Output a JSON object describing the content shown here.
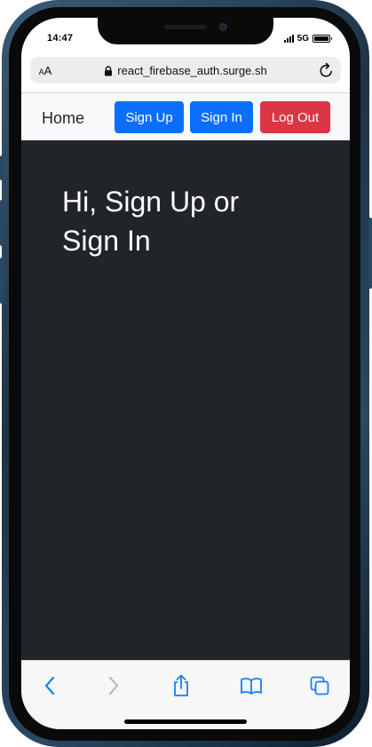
{
  "status_bar": {
    "time": "14:47",
    "network": "5G",
    "signal_icon": "cellular-signal-icon",
    "battery_icon": "battery-icon"
  },
  "browser": {
    "text_size_small": "A",
    "text_size_big": "A",
    "url": "react_firebase_auth.surge.sh",
    "lock_icon": "lock-icon",
    "reload_icon": "reload-icon"
  },
  "navbar": {
    "home_label": "Home",
    "signup_label": "Sign Up",
    "signin_label": "Sign In",
    "logout_label": "Log Out"
  },
  "main": {
    "heading": "Hi, Sign Up or Sign In"
  },
  "toolbar": {
    "icons": [
      "back-icon",
      "forward-icon",
      "share-icon",
      "bookmarks-icon",
      "tabs-icon"
    ]
  },
  "colors": {
    "primary": "#0d6efd",
    "danger": "#dc3545",
    "dark_bg": "#212529",
    "navbar_bg": "#f8f9fa",
    "safari_blue": "#147efb"
  }
}
